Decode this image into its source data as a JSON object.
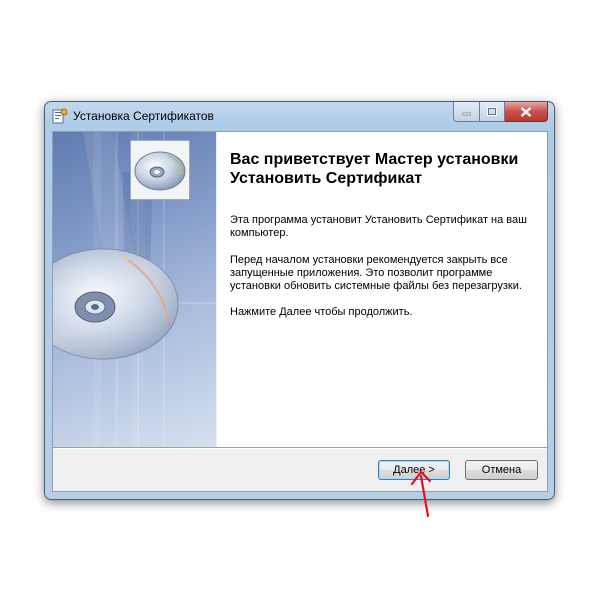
{
  "window": {
    "title": "Установка Сертификатов",
    "icon": "installer-icon"
  },
  "caption_buttons": [
    "minimize",
    "maximize",
    "close"
  ],
  "wizard": {
    "heading": "Вас приветствует Мастер установки Установить Сертификат",
    "paragraph1": "Эта программа установит Установить Сертификат на ваш компьютер.",
    "paragraph2": "Перед началом установки рекомендуется закрыть все запущенные приложения. Это позволит программе установки обновить системные файлы без перезагрузки.",
    "paragraph3": "Нажмите Далее чтобы продолжить.",
    "banner_image": "cd-disc-image",
    "logo_image": "cd-disc-icon"
  },
  "buttons": {
    "next": "Далее >",
    "cancel": "Отмена"
  },
  "annotation": {
    "type": "red-arrow",
    "color": "#e8101c",
    "target": "next-button"
  }
}
